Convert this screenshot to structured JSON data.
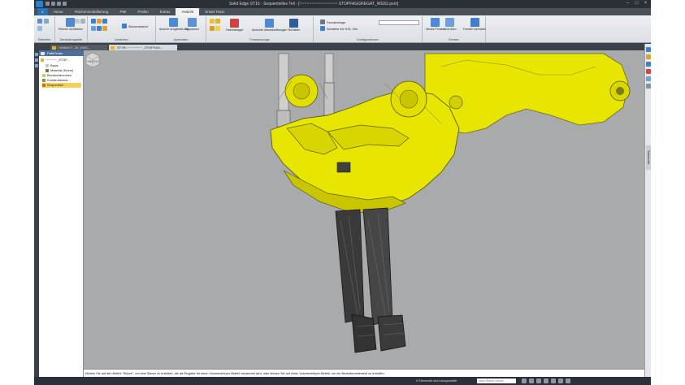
{
  "window": {
    "title": "Solid Edge ST10 - Sequentielles Teil - [~~~~~~~~~~~~~~~~ STOPFAGGREGAT_WG62.psm]"
  },
  "menu_tabs": [
    "Home",
    "Flächenmodellierung",
    "PMI",
    "Prüfen",
    "Extras",
    "Ansicht",
    "Smart Team"
  ],
  "active_tab": "Ansicht",
  "ribbon": {
    "groups": [
      {
        "label": "Teileinfen",
        "buttons": []
      },
      {
        "label": "Darstellungsstile",
        "buttons": [
          "Ebenen sichtbaren"
        ]
      },
      {
        "label": "Ansichten",
        "buttons": [
          "Skizzenansicht"
        ]
      },
      {
        "label": "Ausrichten",
        "buttons": [
          "Ansicht neugliederung",
          "Einpassen"
        ]
      },
      {
        "label": "Formatvorlage",
        "buttons": [
          "Farbmanager",
          "Ansichts überschreibungen",
          "Teil fatten"
        ]
      },
      {
        "label": "Konfigurationen",
        "buttons": [
          "Formatvorlage",
          "Schattiert mit VHS, Obe"
        ]
      },
      {
        "label": "Fenster",
        "buttons": [
          "Neues Fenster",
          "Anordnen",
          "Fenster wechseln"
        ]
      }
    ]
  },
  "doc_tabs": [
    {
      "label": "UNIBAGT_89_KWS...",
      "active": false
    },
    {
      "label": "STYR-~~~~~~~~ _STOPFAG...",
      "active": true
    }
  ],
  "pathfinder": {
    "title": "PathFinder",
    "items": [
      {
        "label": "~~~~~~_STOF...",
        "selected": false
      },
      {
        "label": "Basis",
        "selected": false
      },
      {
        "label": "Material (Keine)",
        "selected": false
      },
      {
        "label": "Bezüsreferenzen",
        "selected": false
      },
      {
        "label": "Konstruktionsr...",
        "selected": false
      },
      {
        "label": "Sequentiell",
        "selected": true
      }
    ]
  },
  "right_dock": {
    "label": "Teilefamilie"
  },
  "viewcube": {
    "label": "HINTEN"
  },
  "prompt": "Klicken Sie auf den Befehl \"Skizze\", um eine Skizze zu erstellen, die als Eingabe für einen Volumenkörper-Befehl verwendet wird, oder klicken Sie auf einen Volumenkörper-Befehl, um ein Bezüsformelement zu erstellen.",
  "status": {
    "selection": "0 Elemente sind ausgewählt",
    "search_placeholder": "Nach Befehl suchen"
  },
  "colors": {
    "model_yellow": "#e8e600",
    "viewport_bg": "#a9aaac",
    "accent_blue": "#2b6fb4",
    "dark_chrome": "#2b2f36"
  }
}
